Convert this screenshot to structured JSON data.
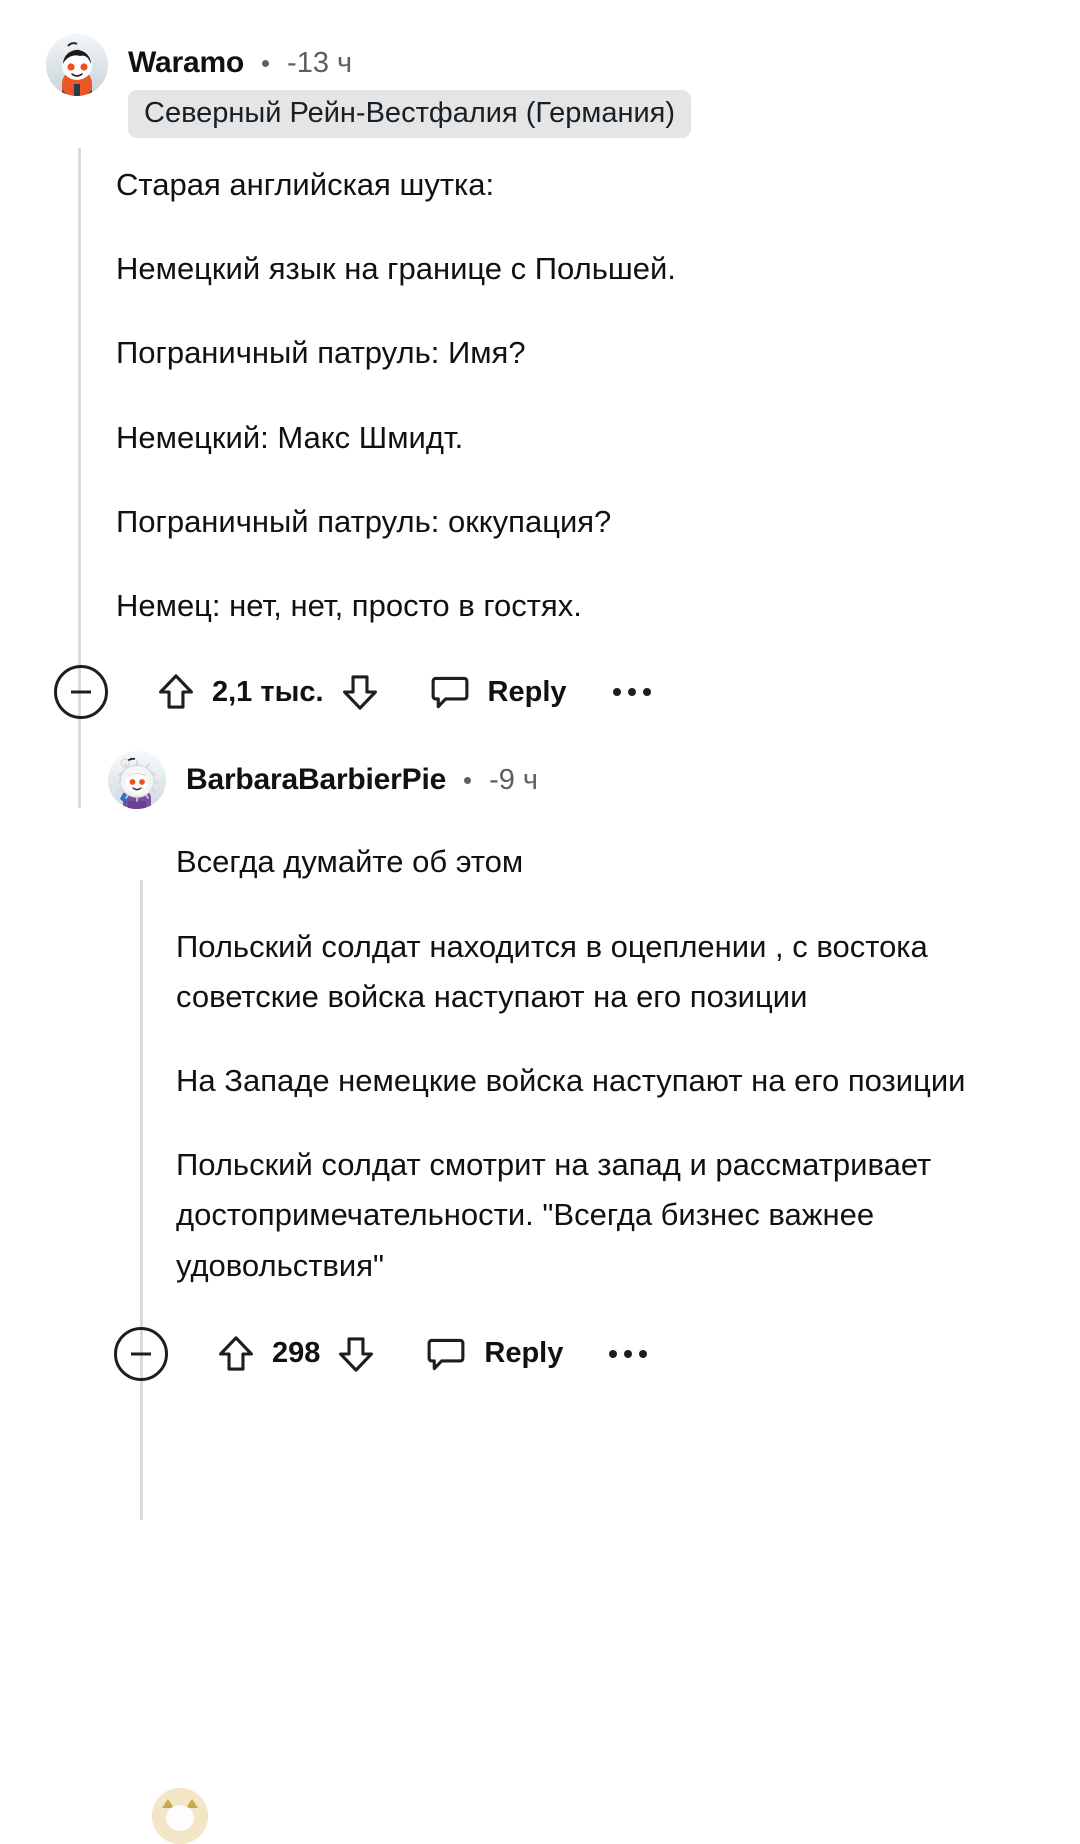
{
  "thread": {
    "comments": [
      {
        "id": "top-comment",
        "author": "Waramo",
        "separator": "•",
        "age": "-13 ч",
        "flair": "Северный Рейн-Вестфалия (Германия)",
        "avatar_icon": "snoo-avatar-orange",
        "paragraphs": [
          "Старая английская шутка:",
          "Немецкий язык на границе с Польшей.",
          "Пограничный патруль: Имя?",
          "Немецкий: Макс Шмидт.",
          "Пограничный патруль: оккупация?",
          "Немец: нет, нет, просто в гостях."
        ],
        "actions": {
          "collapse_icon": "collapse-minus-icon",
          "upvote_icon": "upvote-arrow-icon",
          "score": "2,1 тыс.",
          "downvote_icon": "downvote-arrow-icon",
          "comment_icon": "speech-bubble-icon",
          "reply_label": "Reply",
          "more_icon": "more-options-icon"
        }
      },
      {
        "id": "reply-comment",
        "author": "BarbaraBarbierPie",
        "separator": "•",
        "age": "-9 ч",
        "flair": null,
        "avatar_icon": "snoo-avatar-eskimo",
        "paragraphs": [
          "Всегда думайте об этом",
          "Польский солдат находится в оцеплении , с востока советские войска наступают на его позиции",
          "На Западе немецкие войска наступают на его позиции",
          "Польский солдат смотрит на запад и рассматривает достопримечательности. \"Всегда бизнес важнее удовольствия\""
        ],
        "actions": {
          "collapse_icon": "collapse-minus-icon",
          "upvote_icon": "upvote-arrow-icon",
          "score": "298",
          "downvote_icon": "downvote-arrow-icon",
          "comment_icon": "speech-bubble-icon",
          "reply_label": "Reply",
          "more_icon": "more-options-icon"
        }
      }
    ]
  },
  "colors": {
    "text_primary": "#0f1113",
    "text_muted": "#5c6063",
    "flair_background": "#e4e5e6",
    "thread_line": "#d9dadb",
    "page_background": "#ffffff"
  }
}
